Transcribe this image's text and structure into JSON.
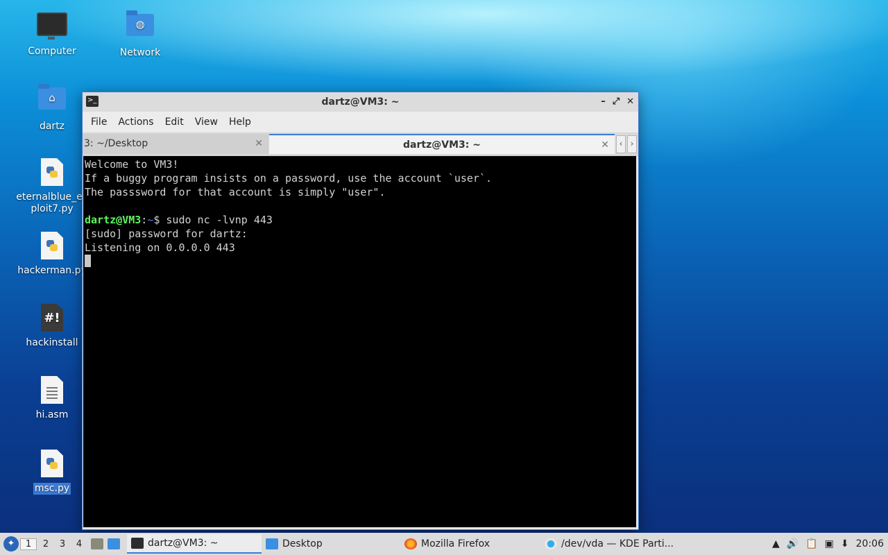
{
  "desktop": {
    "icons": [
      {
        "label": "Computer"
      },
      {
        "label": "Network"
      },
      {
        "label": "dartz"
      },
      {
        "label": "eternalblue_exploit7.py"
      },
      {
        "label": "hackerman.py"
      },
      {
        "label": "hackinstall"
      },
      {
        "label": "hi.asm"
      },
      {
        "label": "msc.py"
      }
    ]
  },
  "window": {
    "title": "dartz@VM3: ~",
    "menu": [
      "File",
      "Actions",
      "Edit",
      "View",
      "Help"
    ],
    "tabs": [
      {
        "label": "3: ~/Desktop"
      },
      {
        "label": "dartz@VM3: ~"
      }
    ],
    "controls": {
      "minimize": "–",
      "maximize": "⤢",
      "close": "✕"
    },
    "tab_close": "✕",
    "tab_prev": "‹",
    "tab_next": "›"
  },
  "terminal": {
    "line1": "Welcome to VM3!",
    "line2": "If a buggy program insists on a password, use the account `user`.",
    "line3": "The passsword for that account is simply \"user\".",
    "prompt_user": "dartz@VM3",
    "prompt_sep": ":",
    "prompt_path": "~",
    "prompt_dollar": "$ ",
    "command": "sudo nc -lvnp 443",
    "line5": "[sudo] password for dartz:",
    "line6": "Listening on 0.0.0.0 443"
  },
  "taskbar": {
    "workspaces": [
      "1",
      "2",
      "3",
      "4"
    ],
    "tasks": [
      {
        "label": "dartz@VM3: ~"
      },
      {
        "label": "Desktop"
      },
      {
        "label": "Mozilla Firefox"
      },
      {
        "label": "/dev/vda — KDE Parti..."
      }
    ],
    "clock": "20:06"
  },
  "colors": {
    "accent": "#3a7bd5",
    "prompt_user": "#5ff55f",
    "prompt_path": "#6a7cff"
  }
}
